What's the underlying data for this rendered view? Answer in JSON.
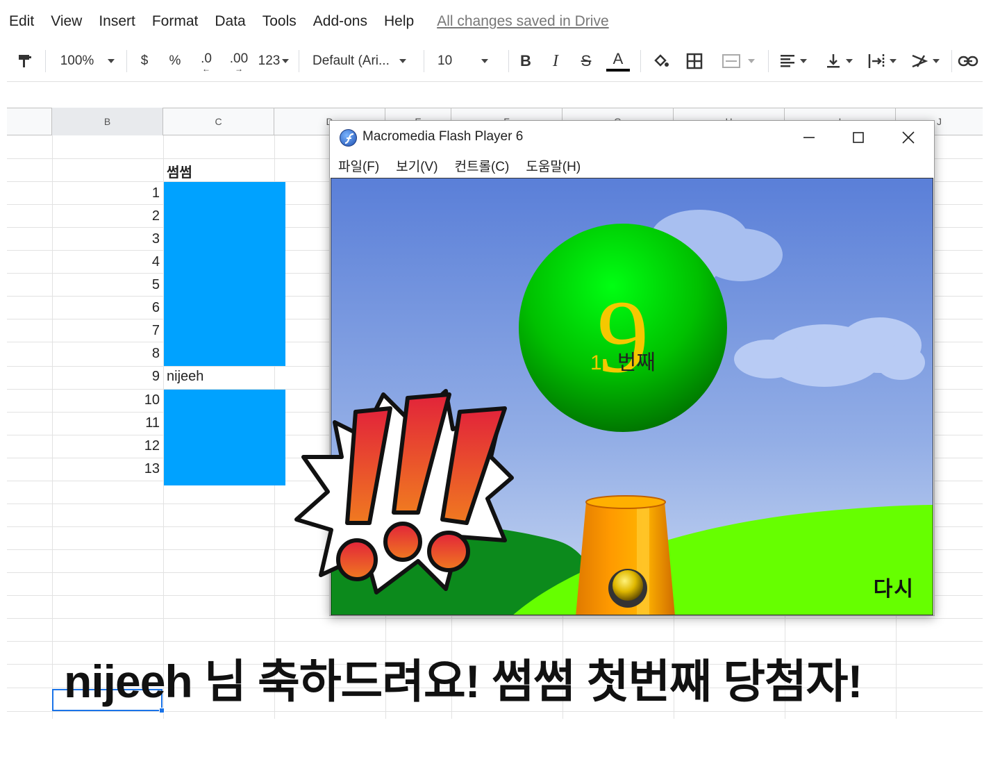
{
  "menu": {
    "items": [
      "Edit",
      "View",
      "Insert",
      "Format",
      "Data",
      "Tools",
      "Add-ons",
      "Help"
    ],
    "saved_status": "All changes saved in Drive"
  },
  "toolbar": {
    "zoom": "100%",
    "currency": "$",
    "percent": "%",
    "decrease_decimal": ".0",
    "increase_decimal": ".00",
    "more_formats": "123",
    "font": "Default (Ari...",
    "font_size": "10",
    "bold": "B",
    "italic": "I",
    "strike": "S",
    "text_color": "A"
  },
  "sheet": {
    "columns": [
      "B",
      "C",
      "D",
      "E",
      "F",
      "G",
      "H",
      "I",
      "J"
    ],
    "header_cell": "썸썸",
    "row_numbers": [
      "1",
      "2",
      "3",
      "4",
      "5",
      "6",
      "7",
      "8",
      "9",
      "10",
      "11",
      "12",
      "13"
    ],
    "winner_cell": "nijeeh",
    "highlight_color": "#00a2ff"
  },
  "flash": {
    "title": "Macromedia Flash Player 6",
    "menu": [
      "파일(F)",
      "보기(V)",
      "컨트롤(C)",
      "도움말(H)"
    ],
    "ball_number": "9",
    "ordinal_number": "1",
    "ordinal_label": "번째",
    "retry_label": "다시",
    "exclaim": "!!!"
  },
  "caption": "nijeeh 님 축하드려요! 썸썸 첫번째 당첨자!"
}
